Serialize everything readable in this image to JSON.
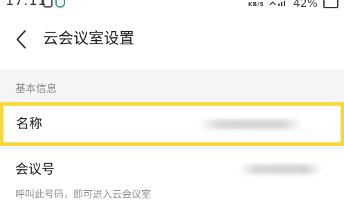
{
  "status_bar": {
    "time": "17:11",
    "speed": "KB/S",
    "battery_text": "42%"
  },
  "header": {
    "back_icon": "chevron-left-icon",
    "title": "云会议室设置"
  },
  "section": {
    "label": "基本信息"
  },
  "rows": {
    "name": {
      "label": "名称",
      "highlight_color": "#f6d83a"
    },
    "meeting_number": {
      "label": "会议号",
      "hint": "呼叫此号码，即可进入云会议室"
    }
  },
  "colors": {
    "background": "#ffffff",
    "section_bg": "#f5f5f5",
    "muted_text": "#8a8a8a",
    "highlight": "#f6d83a"
  }
}
